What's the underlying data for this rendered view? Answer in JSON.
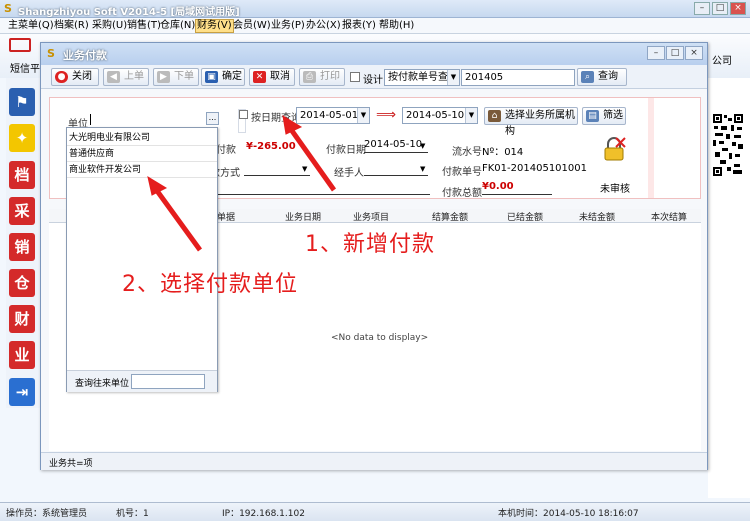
{
  "app": {
    "title": "Shangzhiyou Soft V2014-5 [局域网试用版]",
    "logo": "S"
  },
  "window_controls": {
    "minimize": "–",
    "maximize": "□",
    "close": "×"
  },
  "menu": [
    "主菜单(Q)",
    "档案(R)",
    "采购(U)",
    "销售(T)",
    "仓库(N)",
    "财务(V)",
    "会员(W)",
    "业务(P)",
    "办公(X)",
    "报表(Y)",
    "帮助(H)"
  ],
  "toolbar_strip": {
    "left_label": "短信平",
    "right_label": "公司"
  },
  "dock": [
    {
      "label": "",
      "color": "#2a5fb0"
    },
    {
      "label": "",
      "color": "#e5b500"
    },
    {
      "label": "档",
      "color": "#d42a2a"
    },
    {
      "label": "采",
      "color": "#d42a2a"
    },
    {
      "label": "销",
      "color": "#d42a2a"
    },
    {
      "label": "仓",
      "color": "#d42a2a"
    },
    {
      "label": "财",
      "color": "#d42a2a"
    },
    {
      "label": "业",
      "color": "#d42a2a"
    },
    {
      "label": "",
      "color": "#2a6fd1"
    }
  ],
  "dialog": {
    "title": "业务付款",
    "controls": {
      "minimize": "–",
      "maximize": "□",
      "close": "×"
    },
    "toolbar": {
      "close": "关闭",
      "prev": "上单",
      "next": "下单",
      "confirm": "确定",
      "cancel": "取消",
      "print": "打印",
      "design": "设计",
      "query_mode": "按付款单号查询",
      "query_value": "201405",
      "query_button": "查询"
    },
    "form": {
      "unit_label": "单位",
      "date_query_label": "按日期查询",
      "date_from": "2014-05-01",
      "date_to": "2014-05-10",
      "select_org": "选择业务所属机构",
      "filter": "筛选",
      "pay_label": "实付款",
      "pay_value": "¥-265.00",
      "pay_date_label": "付款日期",
      "pay_date": "2014-05-10",
      "serial_label": "流水号",
      "serial_value": "Nº：014",
      "method_label": "付款方式",
      "handler_label": "经手人",
      "bill_no_label": "付款单号",
      "bill_no": "FK01-201405101001",
      "total_label": "付款总额",
      "total_value": "¥0.00",
      "audit_status": "未审核"
    },
    "grid": {
      "columns": [
        "单据",
        "业务日期",
        "业务项目",
        "结算金额",
        "已结金额",
        "未结金额",
        "本次结算"
      ],
      "empty_text": "<No data to display>"
    },
    "footer": "业务共=项"
  },
  "popup": {
    "items": [
      "大光明电业有限公司",
      "普通供应商",
      "商业软件开发公司"
    ],
    "search_label": "查询往来单位",
    "search_value": ""
  },
  "annotations": {
    "step1": "1、新增付款",
    "step2": "2、选择付款单位"
  },
  "status": {
    "operator": "操作员：系统管理员",
    "machine": "机号：1",
    "ip": "IP：192.168.1.102",
    "time": "本机时间：2014-05-10 18:16:07"
  }
}
